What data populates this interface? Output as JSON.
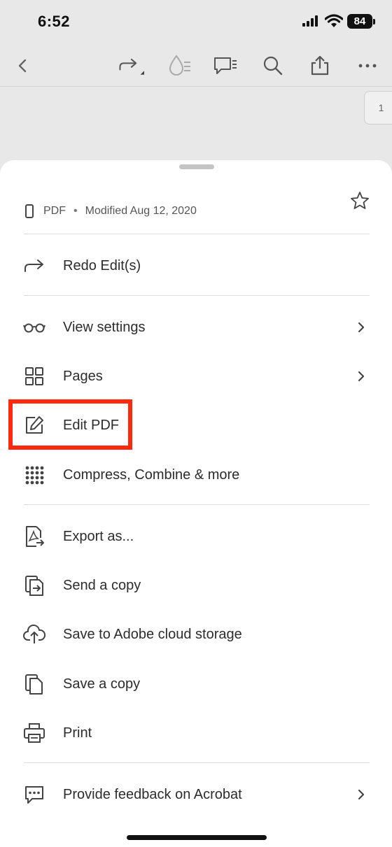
{
  "status_bar": {
    "time": "6:52",
    "battery": "84"
  },
  "toolbar": {
    "items": [
      "back-icon",
      "redo-icon",
      "ink-drop-icon",
      "comment-icon",
      "search-icon",
      "share-icon",
      "more-icon"
    ]
  },
  "page_indicator": "1",
  "sheet": {
    "file_type": "PDF",
    "separator": "•",
    "modified": "Modified Aug 12, 2020",
    "menu": {
      "redo": "Redo Edit(s)",
      "view_settings": "View settings",
      "pages": "Pages",
      "edit_pdf": "Edit PDF",
      "compress_combine": "Compress, Combine & more",
      "export_as": "Export as...",
      "send_copy": "Send a copy",
      "save_cloud": "Save to Adobe cloud storage",
      "save_copy": "Save a copy",
      "print": "Print",
      "feedback": "Provide feedback on Acrobat"
    }
  },
  "colors": {
    "highlight": "#ff2a0e",
    "background": "#e8e8e8",
    "sheet": "#ffffff"
  }
}
